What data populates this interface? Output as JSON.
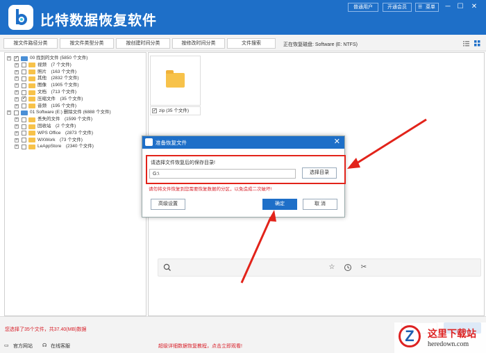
{
  "app": {
    "title": "比特数据恢复软件"
  },
  "topbar": {
    "buttons": [
      "普通用户",
      "开通会员",
      "菜单"
    ],
    "window_controls": [
      "─",
      "☐",
      "✕"
    ]
  },
  "tabs": [
    "按文件路径分类",
    "按文件类型分类",
    "按创建时间分类",
    "按修改时间分类",
    "文件搜索"
  ],
  "scan_status": "正在恢复磁盘: Software (E: NTFS)",
  "tree": [
    {
      "label": "00 找到的文件 (5850 个文件)",
      "level": 0,
      "checked": true,
      "type": "drive"
    },
    {
      "label": "视频　(7 个文件)",
      "level": 1,
      "checked": false,
      "type": "folder"
    },
    {
      "label": "照片　(163 个文件)",
      "level": 1,
      "checked": false,
      "type": "folder"
    },
    {
      "label": "其他　(2832 个文件)",
      "level": 1,
      "checked": false,
      "type": "folder"
    },
    {
      "label": "图像　(1905 个文件)",
      "level": 1,
      "checked": false,
      "type": "folder"
    },
    {
      "label": "文档　(713 个文件)",
      "level": 1,
      "checked": false,
      "type": "folder"
    },
    {
      "label": "压缩文件　(35 个文件)",
      "level": 1,
      "checked": true,
      "type": "folder"
    },
    {
      "label": "音频　(195 个文件)",
      "level": 1,
      "checked": false,
      "type": "folder"
    },
    {
      "label": "01 Software (E:) 删除文件 (6888 个文件)",
      "level": 0,
      "checked": false,
      "type": "drive"
    },
    {
      "label": "丢失的文件　(1599 个文件)",
      "level": 1,
      "checked": false,
      "type": "folder"
    },
    {
      "label": "回收站　(2 个文件)",
      "level": 1,
      "checked": false,
      "type": "folder"
    },
    {
      "label": "WPS Office　(2873 个文件)",
      "level": 1,
      "checked": false,
      "type": "folder"
    },
    {
      "label": "WXWork　(73 个文件)",
      "level": 1,
      "checked": false,
      "type": "folder"
    },
    {
      "label": "LeAppStore　(2340 个文件)",
      "level": 1,
      "checked": false,
      "type": "folder"
    }
  ],
  "file_item": {
    "label": "zip (35 个文件)",
    "checked": true
  },
  "dialog": {
    "title": "准备恢复文件",
    "prompt": "请选择文件恢复后的保存目录!",
    "path_value": "G:\\",
    "choose_dir_label": "选择目录",
    "warning": "请勿将文件恢复到您需要恢复数据的分区，以免造成二次破坏!",
    "advanced_label": "高级设置",
    "ok_label": "确定",
    "cancel_label": "取 消"
  },
  "status": {
    "selection_text": "您选择了35个文件，共37.40(MB)数据",
    "official_site": "官方网站",
    "online_service": "在线客服",
    "tutorial_notice": "超级详细数据恢复教程，点击立即观看!"
  },
  "watermark": {
    "logo": "Z",
    "title": "这里下载站",
    "url": "heredown.com"
  },
  "colors": {
    "brand_blue": "#1e6fc8",
    "warning_red": "#d8202a",
    "arrow_red": "#e2231a"
  }
}
